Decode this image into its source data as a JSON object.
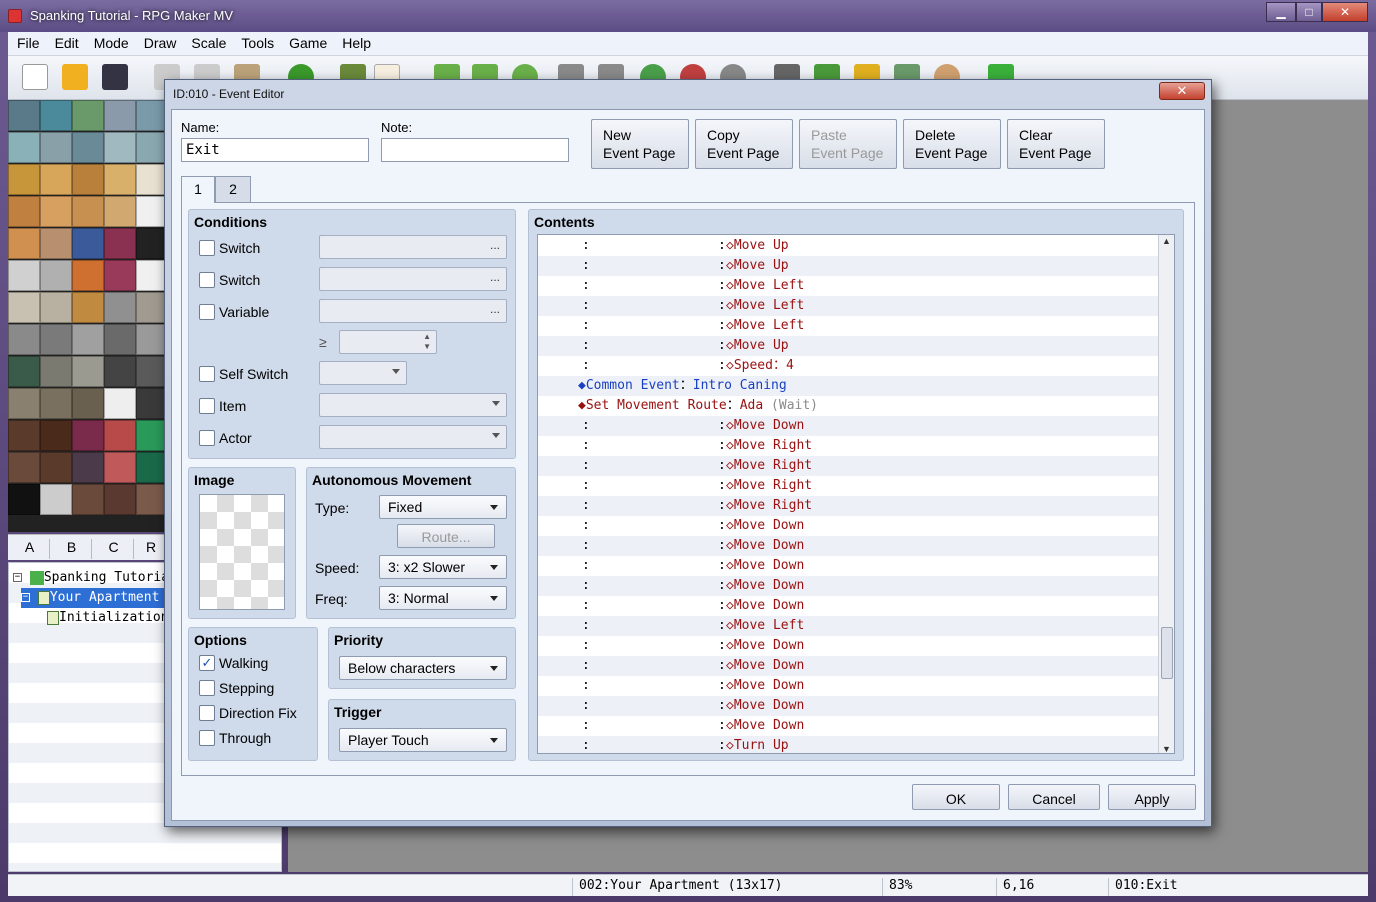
{
  "window": {
    "title": "Spanking Tutorial - RPG Maker MV",
    "minimize": "▁",
    "maximize": "□",
    "close": "✕"
  },
  "menu": [
    "File",
    "Edit",
    "Mode",
    "Draw",
    "Scale",
    "Tools",
    "Game",
    "Help"
  ],
  "toolbar_icons": [
    "new-project-icon",
    "open-project-icon",
    "save-icon",
    "cut-icon",
    "copy-icon",
    "paste-icon",
    "undo-icon",
    "map-mode-icon",
    "event-mode-icon",
    "pencil-icon",
    "rectangle-icon",
    "ellipse-icon",
    "fill-icon",
    "shadow-pen-icon",
    "zoom-in-icon",
    "zoom-out-icon",
    "actual-size-icon",
    "database-icon",
    "plugin-manager-icon",
    "sound-test-icon",
    "event-searcher-icon",
    "character-generator-icon",
    "playtest-icon"
  ],
  "tileset_tabs": [
    "A",
    "B",
    "C",
    "R"
  ],
  "map_tree": [
    {
      "label": "Spanking Tutorial",
      "level": 0,
      "selected": false
    },
    {
      "label": "Your Apartment",
      "level": 1,
      "selected": true
    },
    {
      "label": "Initialization",
      "level": 2,
      "selected": false
    }
  ],
  "status": {
    "map": "002:Your Apartment (13x17)",
    "zoom": "83%",
    "coords": "6,16",
    "event": "010:Exit"
  },
  "dialog": {
    "title": "ID:010 - Event Editor",
    "close": "✕",
    "name_label": "Name:",
    "name_value": "Exit",
    "note_label": "Note:",
    "note_value": "",
    "buttons": {
      "new_page": [
        "New",
        "Event Page"
      ],
      "copy_page": [
        "Copy",
        "Event Page"
      ],
      "paste_page": [
        "Paste",
        "Event Page"
      ],
      "delete_page": [
        "Delete",
        "Event Page"
      ],
      "clear_page": [
        "Clear",
        "Event Page"
      ]
    },
    "tabs": [
      "1",
      "2"
    ],
    "conditions": {
      "title": "Conditions",
      "switch1": "Switch",
      "switch2": "Switch",
      "variable": "Variable",
      "gte": "≥",
      "self_switch": "Self Switch",
      "item": "Item",
      "actor": "Actor",
      "dots": "..."
    },
    "image": {
      "title": "Image"
    },
    "autonomous": {
      "title": "Autonomous Movement",
      "type_label": "Type:",
      "type_value": "Fixed",
      "route_button": "Route...",
      "speed_label": "Speed:",
      "speed_value": "3: x2 Slower",
      "freq_label": "Freq:",
      "freq_value": "3: Normal"
    },
    "options": {
      "title": "Options",
      "walking": "Walking",
      "stepping": "Stepping",
      "direction_fix": "Direction Fix",
      "through": "Through",
      "walking_checked": "✓"
    },
    "priority": {
      "title": "Priority",
      "value": "Below characters"
    },
    "trigger": {
      "title": "Trigger",
      "value": "Player Touch"
    },
    "contents": {
      "title": "Contents",
      "commands": [
        {
          "type": "route",
          "text": "◇Move Up"
        },
        {
          "type": "route",
          "text": "◇Move Up"
        },
        {
          "type": "route",
          "text": "◇Move Left"
        },
        {
          "type": "route",
          "text": "◇Move Left"
        },
        {
          "type": "route",
          "text": "◇Move Left"
        },
        {
          "type": "route",
          "text": "◇Move Up"
        },
        {
          "type": "route",
          "text": "◇Speed：4"
        },
        {
          "type": "common",
          "cmd": "◆Common Event",
          "sep": "：",
          "arg": "Intro Caning"
        },
        {
          "type": "move",
          "cmd": "◆Set Movement Route",
          "sep": "：",
          "arg": "Ada",
          "extra": "(Wait)"
        },
        {
          "type": "route",
          "text": "◇Move Down"
        },
        {
          "type": "route",
          "text": "◇Move Right"
        },
        {
          "type": "route",
          "text": "◇Move Right"
        },
        {
          "type": "route",
          "text": "◇Move Right"
        },
        {
          "type": "route",
          "text": "◇Move Right"
        },
        {
          "type": "route",
          "text": "◇Move Down"
        },
        {
          "type": "route",
          "text": "◇Move Down"
        },
        {
          "type": "route",
          "text": "◇Move Down"
        },
        {
          "type": "route",
          "text": "◇Move Down"
        },
        {
          "type": "route",
          "text": "◇Move Down"
        },
        {
          "type": "route",
          "text": "◇Move Left"
        },
        {
          "type": "route",
          "text": "◇Move Down"
        },
        {
          "type": "route",
          "text": "◇Move Down"
        },
        {
          "type": "route",
          "text": "◇Move Down"
        },
        {
          "type": "route",
          "text": "◇Move Down"
        },
        {
          "type": "route",
          "text": "◇Move Down"
        },
        {
          "type": "route",
          "text": "◇Turn Up"
        }
      ]
    },
    "ok": "OK",
    "cancel": "Cancel",
    "apply": "Apply"
  }
}
